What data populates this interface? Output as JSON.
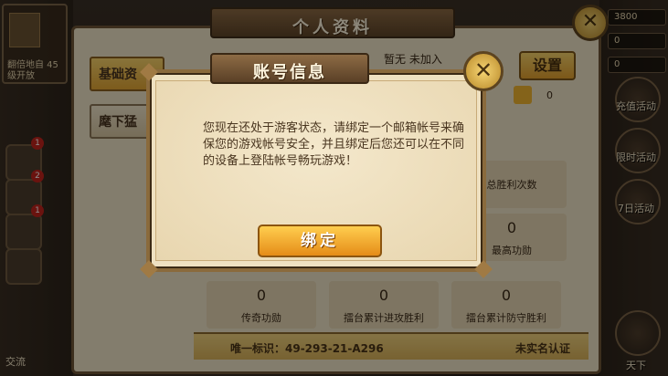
{
  "background": {
    "top_left": {
      "level_text": "翻倍地自\n45级开放"
    },
    "badges": [
      "1",
      "2",
      "1"
    ],
    "bottom_left_label": "交流",
    "resources": [
      "3800",
      "0",
      "0"
    ],
    "right_buttons": [
      "充值活动",
      "限时活动",
      "7日活动"
    ],
    "bottom_right_label": "天下"
  },
  "panel": {
    "title": "个人资料",
    "tabs": [
      {
        "label": "基础资"
      },
      {
        "label": "麾下猛"
      }
    ],
    "settings_label": "设置",
    "like_count": "0",
    "header_fragment": "暂无 未加入",
    "stats": [
      {
        "value": "",
        "label": "总胜利次数"
      },
      {
        "value": "0",
        "label": "最高功勋"
      },
      {
        "value": "0",
        "label": "传奇功勋"
      },
      {
        "value": "0",
        "label": "擂台累计进攻胜利"
      },
      {
        "value": "0",
        "label": "擂台累计防守胜利"
      }
    ],
    "id_text": "唯一标识：49-293-21-A296",
    "realname_text": "未实名认证"
  },
  "dialog": {
    "title": "账号信息",
    "message": "您现在还处于游客状态，请绑定一个邮箱帐号来确保您的游戏帐号安全，并且绑定后您还可以在不同的设备上登陆帐号畅玩游戏！",
    "bind_label": "绑定"
  },
  "colors": {
    "accent_gold": "#e3a634",
    "panel_bg": "#efe3c6",
    "title_brown": "#5e4428"
  }
}
